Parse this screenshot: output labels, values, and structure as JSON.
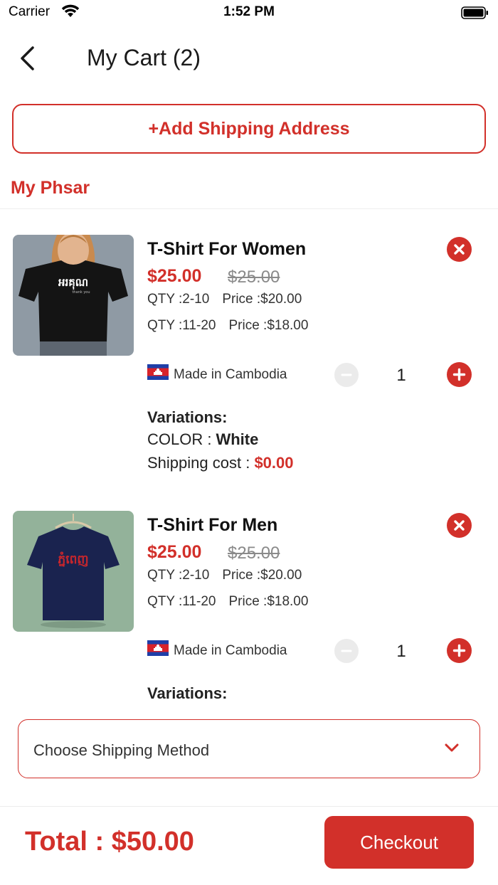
{
  "status_bar": {
    "carrier": "Carrier",
    "time": "1:52 PM"
  },
  "nav": {
    "title": "My Cart (2)"
  },
  "add_address_label": "+Add Shipping Address",
  "store": {
    "name": "My Phsar"
  },
  "items": [
    {
      "title": "T-Shirt For Women",
      "price": "$25.00",
      "old_price": "$25.00",
      "tiers": [
        {
          "qty": "QTY :2-10",
          "price": "Price :$20.00"
        },
        {
          "qty": "QTY :11-20",
          "price": "Price :$18.00"
        }
      ],
      "origin": "Made in Cambodia",
      "quantity": "1",
      "variations_label": "Variations:",
      "color_label": "COLOR :",
      "color_value": "White",
      "shipping_label": "Shipping cost :",
      "shipping_value": "$0.00",
      "shirt_print": "អរគុណ",
      "shirt_sub": "thank you"
    },
    {
      "title": "T-Shirt For Men",
      "price": "$25.00",
      "old_price": "$25.00",
      "tiers": [
        {
          "qty": "QTY :2-10",
          "price": "Price :$20.00"
        },
        {
          "qty": "QTY :11-20",
          "price": "Price :$18.00"
        }
      ],
      "origin": "Made in Cambodia",
      "quantity": "1",
      "variations_label": "Variations:",
      "shirt_print": "ភ្នំពេញ"
    }
  ],
  "shipping_method": {
    "placeholder": "Choose Shipping Method"
  },
  "footer": {
    "total": "Total : $50.00",
    "checkout_label": "Checkout"
  },
  "colors": {
    "accent": "#d2302a",
    "muted": "#8a8a8a",
    "disabled": "#ebebeb"
  }
}
